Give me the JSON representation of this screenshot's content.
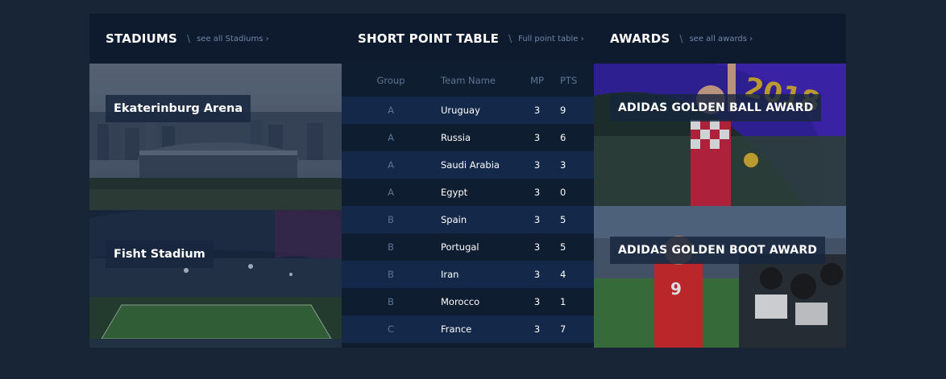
{
  "stadiums": {
    "title": "STADIUMS",
    "separator": "\\",
    "see_all": "see all Stadiums ›",
    "items": [
      {
        "name": "Ekaterinburg Arena"
      },
      {
        "name": "Fisht Stadium"
      }
    ]
  },
  "table": {
    "title": "SHORT POINT TABLE",
    "separator": "\\",
    "full_link": "Full point table ›",
    "headers": {
      "group": "Group",
      "team": "Team Name",
      "mp": "MP",
      "pts": "PTS"
    },
    "rows": [
      {
        "group": "A",
        "team": "Uruguay",
        "mp": "3",
        "pts": "9"
      },
      {
        "group": "A",
        "team": "Russia",
        "mp": "3",
        "pts": "6"
      },
      {
        "group": "A",
        "team": "Saudi Arabia",
        "mp": "3",
        "pts": "3"
      },
      {
        "group": "A",
        "team": "Egypt",
        "mp": "3",
        "pts": "0"
      },
      {
        "group": "B",
        "team": "Spain",
        "mp": "3",
        "pts": "5"
      },
      {
        "group": "B",
        "team": "Portugal",
        "mp": "3",
        "pts": "5"
      },
      {
        "group": "B",
        "team": "Iran",
        "mp": "3",
        "pts": "4"
      },
      {
        "group": "B",
        "team": "Morocco",
        "mp": "3",
        "pts": "1"
      },
      {
        "group": "C",
        "team": "France",
        "mp": "3",
        "pts": "7"
      }
    ]
  },
  "awards": {
    "title": "AWARDS",
    "separator": "\\",
    "see_all": "see all awards ›",
    "items": [
      {
        "name": "ADIDAS GOLDEN BALL AWARD",
        "banner_text": "2018"
      },
      {
        "name": "ADIDAS GOLDEN BOOT AWARD",
        "shirt_number": "9"
      }
    ]
  },
  "colors": {
    "page_bg": "#172537",
    "panel_bg": "#0f1d31",
    "row_highlight": "#14294a",
    "muted_text": "#5d7593"
  }
}
